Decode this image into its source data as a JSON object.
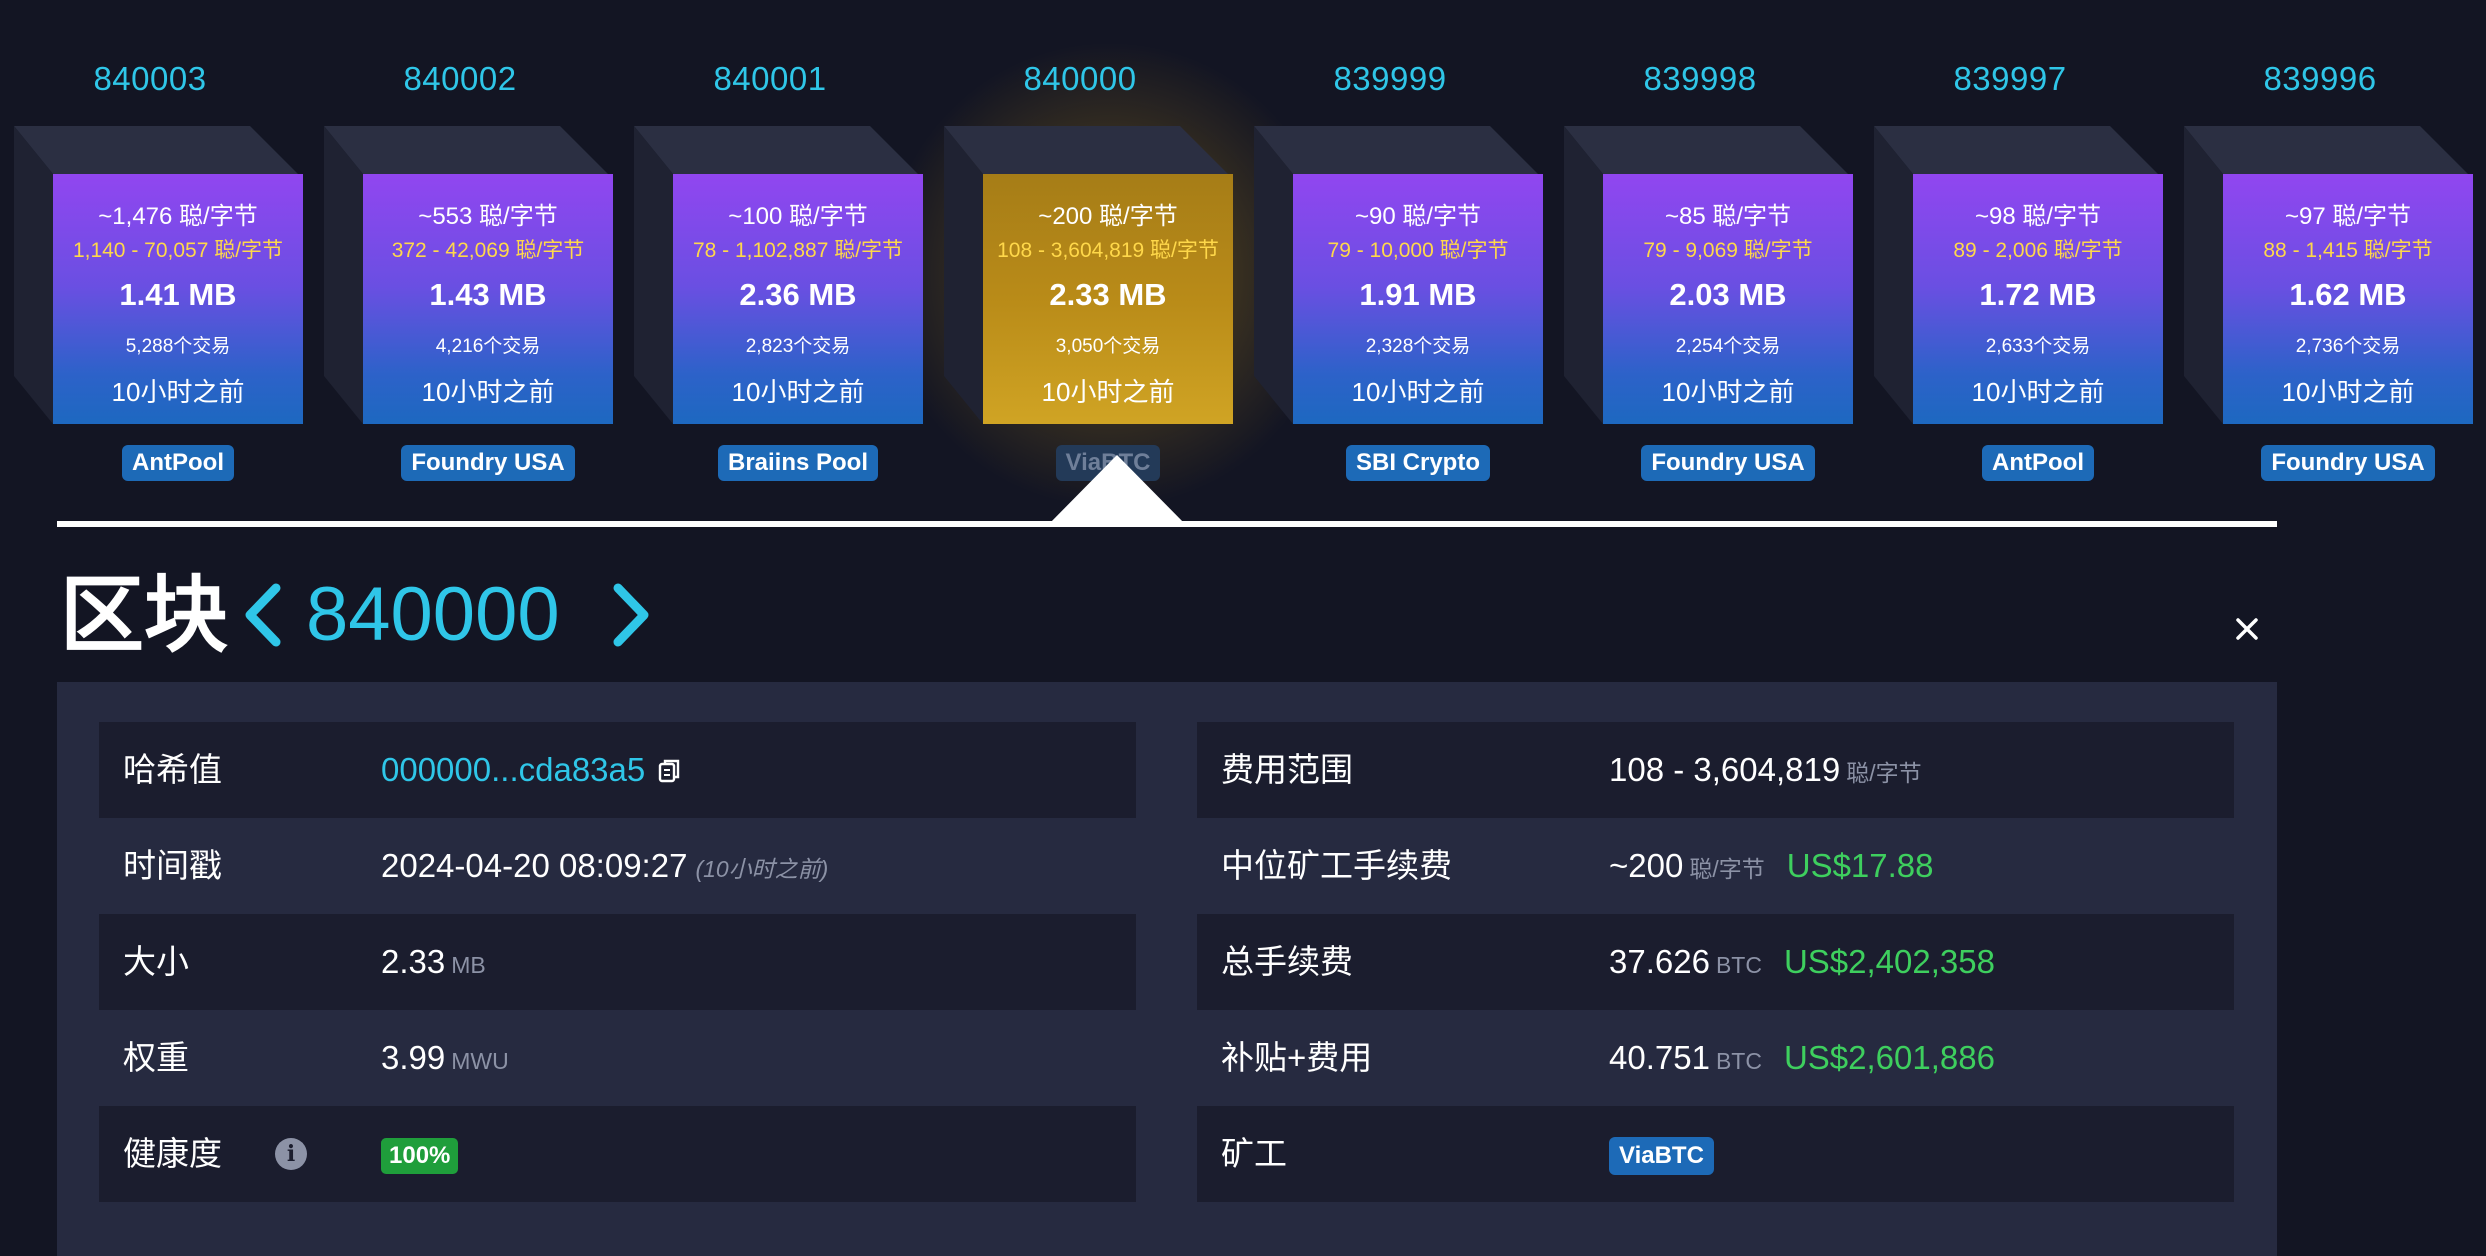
{
  "blocks": [
    {
      "height": "840003",
      "median_fee": "~1,476 聪/字节",
      "fee_range": "1,140 - 70,057 聪/字节",
      "size": "1.41 MB",
      "tx_count": "5,288个交易",
      "time_ago": "10小时之前",
      "pool": "AntPool"
    },
    {
      "height": "840002",
      "median_fee": "~553 聪/字节",
      "fee_range": "372 - 42,069 聪/字节",
      "size": "1.43 MB",
      "tx_count": "4,216个交易",
      "time_ago": "10小时之前",
      "pool": "Foundry USA"
    },
    {
      "height": "840001",
      "median_fee": "~100 聪/字节",
      "fee_range": "78 - 1,102,887 聪/字节",
      "size": "2.36 MB",
      "tx_count": "2,823个交易",
      "time_ago": "10小时之前",
      "pool": "Braiins Pool"
    },
    {
      "height": "840000",
      "median_fee": "~200 聪/字节",
      "fee_range": "108 - 3,604,819 聪/字节",
      "size": "2.33 MB",
      "tx_count": "3,050个交易",
      "time_ago": "10小时之前",
      "pool": "ViaBTC"
    },
    {
      "height": "839999",
      "median_fee": "~90 聪/字节",
      "fee_range": "79 - 10,000 聪/字节",
      "size": "1.91 MB",
      "tx_count": "2,328个交易",
      "time_ago": "10小时之前",
      "pool": "SBI Crypto"
    },
    {
      "height": "839998",
      "median_fee": "~85 聪/字节",
      "fee_range": "79 - 9,069 聪/字节",
      "size": "2.03 MB",
      "tx_count": "2,254个交易",
      "time_ago": "10小时之前",
      "pool": "Foundry USA"
    },
    {
      "height": "839997",
      "median_fee": "~98 聪/字节",
      "fee_range": "89 - 2,006 聪/字节",
      "size": "1.72 MB",
      "tx_count": "2,633个交易",
      "time_ago": "10小时之前",
      "pool": "AntPool"
    },
    {
      "height": "839996",
      "median_fee": "~97 聪/字节",
      "fee_range": "88 - 1,415 聪/字节",
      "size": "1.62 MB",
      "tx_count": "2,736个交易",
      "time_ago": "10小时之前",
      "pool": "Foundry USA"
    }
  ],
  "selected_index": 3,
  "title": {
    "label": "区块",
    "number": "840000",
    "prev_icon": "chevron-left-icon",
    "next_icon": "chevron-right-icon",
    "close_icon": "close-icon"
  },
  "details": {
    "left": [
      {
        "label": "哈希值",
        "value": "000000...cda83a5",
        "icon": "copy-icon"
      },
      {
        "label": "时间戳",
        "value": "2024-04-20 08:09:27",
        "ago": "(10小时之前)"
      },
      {
        "label": "大小",
        "value": "2.33",
        "unit": "MB"
      },
      {
        "label": "权重",
        "value": "3.99",
        "unit": "MWU"
      },
      {
        "label": "健康度",
        "value": "100%",
        "icon": "info-icon",
        "info_glyph": "i"
      }
    ],
    "right": [
      {
        "label": "费用范围",
        "value": "108 - 3,604,819",
        "unit": "聪/字节"
      },
      {
        "label": "中位矿工手续费",
        "value": "~200",
        "unit": "聪/字节",
        "usd": "US$17.88"
      },
      {
        "label": "总手续费",
        "value": "37.626",
        "unit": "BTC",
        "usd": "US$2,402,358"
      },
      {
        "label": "补贴+费用",
        "value": "40.751",
        "unit": "BTC",
        "usd": "US$2,601,886"
      },
      {
        "label": "矿工",
        "value": "ViaBTC"
      }
    ]
  },
  "colors": {
    "accent": "#2fc6e8",
    "usd_green": "#3ecf5e",
    "fee_yellow": "#ffd84a",
    "badge_blue": "#1d6ab7",
    "health_green": "#1f9e3b",
    "current_gold": "#b98b18"
  }
}
